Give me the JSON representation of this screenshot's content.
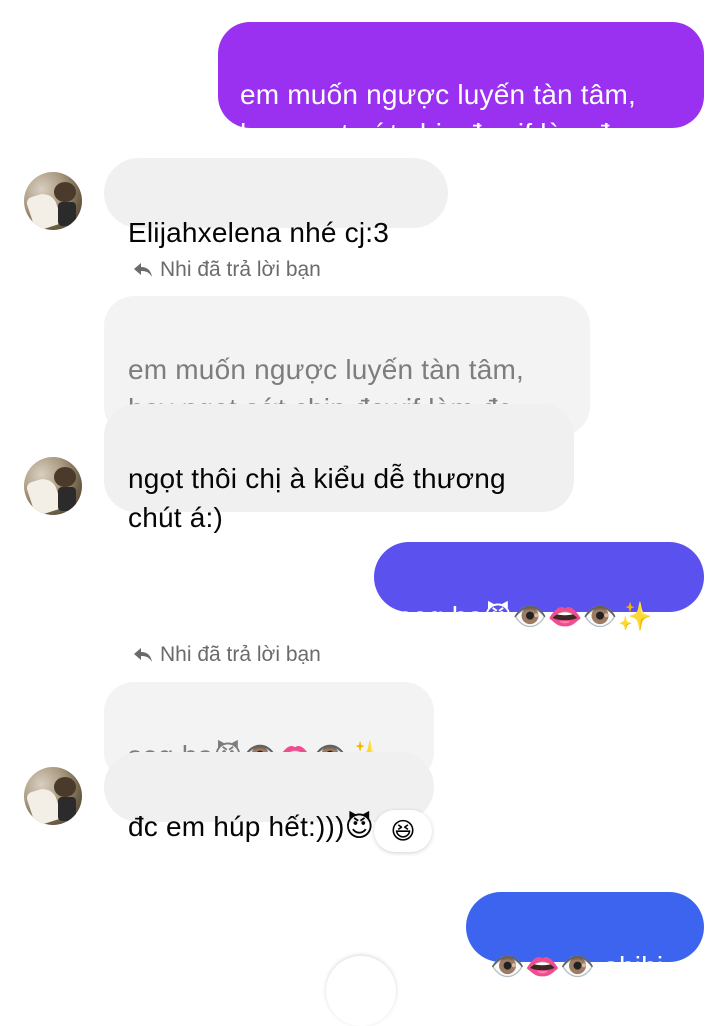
{
  "messages": {
    "m1": {
      "text": "em muốn ngược luyến tàn tâm,\nhay ngọt sớt chin đewjf làm đc"
    },
    "m2": {
      "text": "Elijahxelena nhé  cj:3"
    },
    "reply1": {
      "label": "Nhi đã trả lời bạn",
      "quoted": "em muốn ngược luyến tàn tâm,\nhay ngọt sớt chin đewjf làm đc",
      "text": "ngọt thôi chị à kiểu dễ thương\nchút á:)"
    },
    "m3": {
      "text": "seg ha😈👁️👄👁️✨"
    },
    "reply2": {
      "label": "Nhi đã trả lời bạn",
      "quoted": "seg ha😈👁️👄👁️✨",
      "text": "đc em húp hết:)))😈",
      "reaction": "😆"
    },
    "m4": {
      "text": "👁️👄👁️ ahihi"
    }
  },
  "icons": {
    "reply": "reply-arrow-icon",
    "avatar": "profile-photo"
  },
  "colors": {
    "sent_purple": "#9b31f0",
    "sent_violet": "#5a51ef",
    "sent_blue": "#3d64ee",
    "received_bg": "#f0f0f0",
    "quoted_text": "#7d7d7d"
  }
}
